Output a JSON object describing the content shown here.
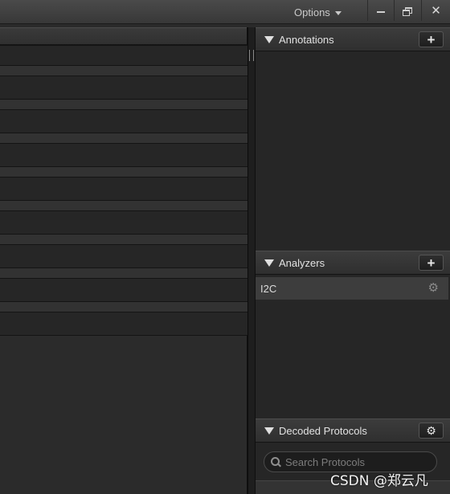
{
  "titlebar": {
    "options_label": "Options"
  },
  "channels": {
    "row_count": 9
  },
  "sidebar": {
    "annotations": {
      "title": "Annotations",
      "add_label": "+"
    },
    "analyzers": {
      "title": "Analyzers",
      "add_label": "+",
      "items": [
        {
          "label": "I2C"
        }
      ]
    },
    "decoded_protocols": {
      "title": "Decoded Protocols",
      "search_placeholder": "Search Protocols"
    }
  },
  "watermark": "CSDN @郑云凡"
}
